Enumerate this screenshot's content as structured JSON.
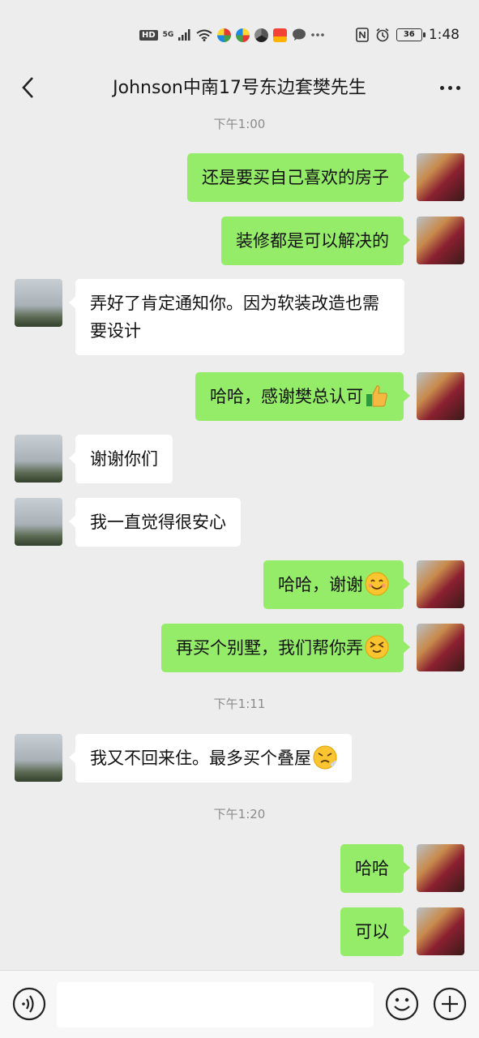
{
  "status_bar": {
    "network_badge": "HD",
    "signal_label": "5G",
    "time": "1:48",
    "battery": "36"
  },
  "header": {
    "title": "Johnson中南17号东边套樊先生"
  },
  "timestamps": {
    "t1": "下午1:00",
    "t2": "下午1:11",
    "t3": "下午1:20"
  },
  "messages": {
    "m1": "还是要买自己喜欢的房子",
    "m2": "装修都是可以解决的",
    "m3": "弄好了肯定通知你。因为软装改造也需要设计",
    "m4": "哈哈，感谢樊总认可",
    "m5": "谢谢你们",
    "m6": "我一直觉得很安心",
    "m7": "哈哈，谢谢",
    "m8": "再买个别墅，我们帮你弄",
    "m9": "我又不回来住。最多买个叠屋",
    "m10": "哈哈",
    "m11": "可以"
  },
  "emojis": {
    "m4": "thumbs-up-icon",
    "m7": "smile-icon",
    "m8": "laughing-squint-icon",
    "m9": "frustrated-icon"
  },
  "colors": {
    "my_bubble": "#95ec69",
    "their_bubble": "#ffffff",
    "background": "#ededed"
  },
  "input": {
    "placeholder": ""
  }
}
